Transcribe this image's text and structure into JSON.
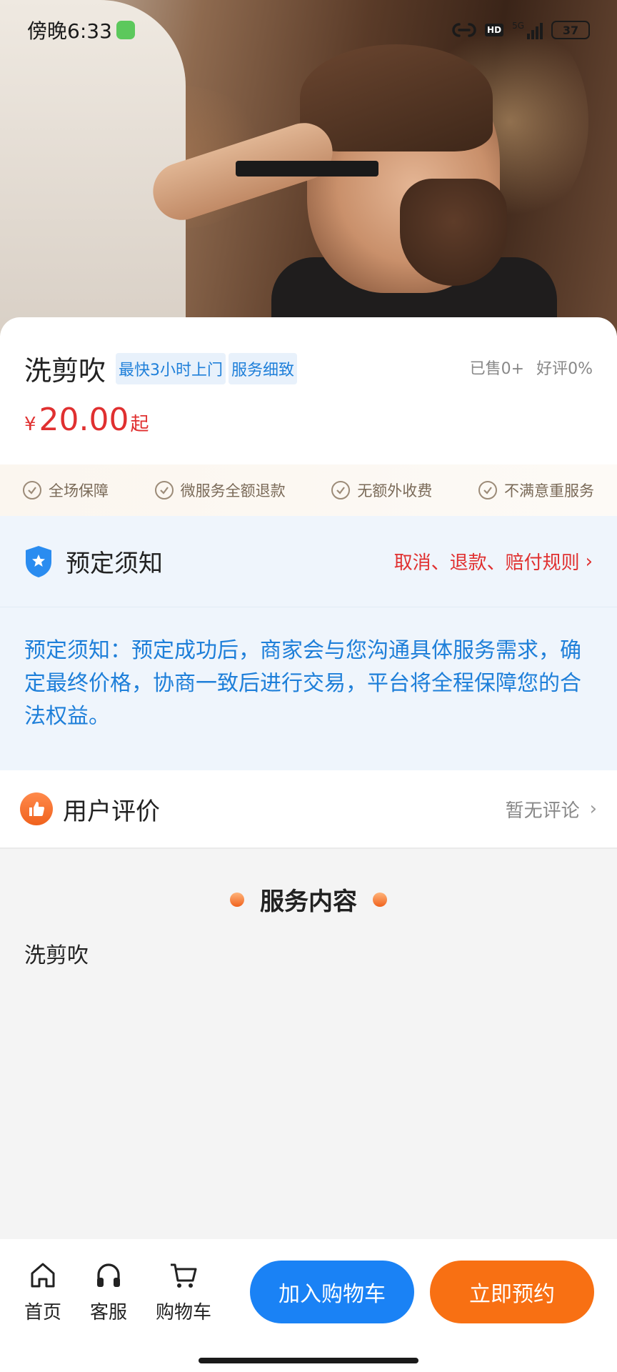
{
  "status_bar": {
    "time": "傍晚6:33",
    "network": "5G",
    "hd": "HD",
    "battery": "37"
  },
  "product": {
    "title": "洗剪吹",
    "tags": [
      "最快3小时上门",
      "服务细致"
    ],
    "sold": "已售0+",
    "rating": "好评0%",
    "price_currency": "¥",
    "price_value": "20.00",
    "price_suffix": "起"
  },
  "guarantees": [
    "全场保障",
    "微服务全额退款",
    "无额外收费",
    "不满意重服务"
  ],
  "notice": {
    "title": "预定须知",
    "link": "取消、退款、赔付规则",
    "body": "预定须知：预定成功后，商家会与您沟通具体服务需求，确定最终价格，协商一致后进行交易，平台将全程保障您的合法权益。"
  },
  "review": {
    "title": "用户评价",
    "empty_text": "暂无评论"
  },
  "service_content": {
    "title": "服务内容",
    "text": "洗剪吹"
  },
  "bottom_bar": {
    "home": "首页",
    "service": "客服",
    "cart": "购物车",
    "add_to_cart": "加入购物车",
    "book_now": "立即预约"
  },
  "colors": {
    "accent_blue": "#1a82f5",
    "accent_orange": "#f87013",
    "price_red": "#e03030",
    "notice_blue": "#1e7fd9"
  },
  "icons": [
    "app-icon",
    "link-icon",
    "hd-icon",
    "signal-icon",
    "battery-icon",
    "check-icon",
    "shield-icon",
    "thumbs-up-icon",
    "chevron-right-icon",
    "home-icon",
    "headset-icon",
    "cart-icon"
  ]
}
